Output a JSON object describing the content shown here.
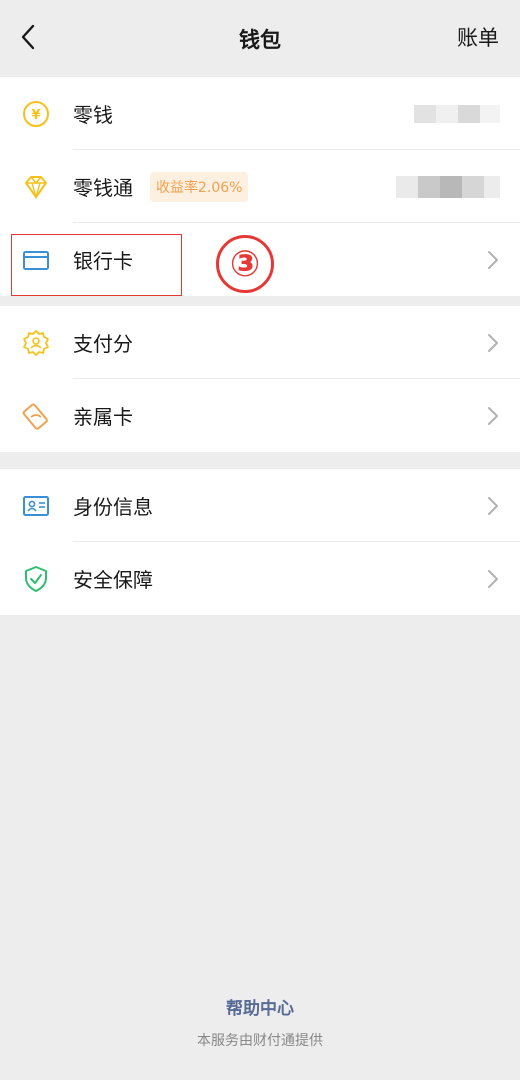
{
  "header": {
    "title": "钱包",
    "bill_label": "账单"
  },
  "groups": [
    {
      "items": [
        {
          "label": "零钱"
        },
        {
          "label": "零钱通",
          "badge": "收益率2.06%"
        },
        {
          "label": "银行卡"
        }
      ]
    },
    {
      "items": [
        {
          "label": "支付分"
        },
        {
          "label": "亲属卡"
        }
      ]
    },
    {
      "items": [
        {
          "label": "身份信息"
        },
        {
          "label": "安全保障"
        }
      ]
    }
  ],
  "annotation": {
    "step_marker": "③"
  },
  "footer": {
    "help_center": "帮助中心",
    "provider_note": "本服务由财付通提供"
  },
  "icons": {
    "change": "yen-coin-icon",
    "lingqiantong": "diamond-icon",
    "bank_card": "bank-card-icon",
    "pay_score": "pay-score-badge-icon",
    "family_card": "family-card-icon",
    "identity": "id-card-icon",
    "security": "shield-check-icon"
  },
  "colors": {
    "accent_yellow": "#f5c21b",
    "accent_blue": "#3b8fd6",
    "accent_green": "#2fbf71",
    "link": "#576b95",
    "badge_text": "#f2a14f",
    "annotation_red": "#e53935"
  }
}
